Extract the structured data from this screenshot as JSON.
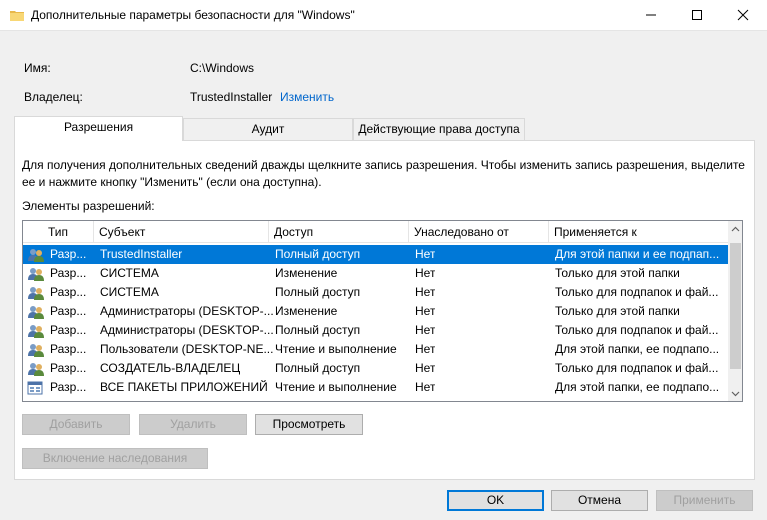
{
  "window": {
    "title": "Дополнительные параметры безопасности  для \"Windows\"",
    "minimize_glyph": "—",
    "maximize_glyph": "☐",
    "close_glyph": "✕"
  },
  "info": {
    "name_label": "Имя:",
    "name_value": "C:\\Windows",
    "owner_label": "Владелец:",
    "owner_value": "TrustedInstaller",
    "change_link": "Изменить"
  },
  "tabs": [
    {
      "label": "Разрешения",
      "active": true
    },
    {
      "label": "Аудит",
      "active": false
    },
    {
      "label": "Действующие права доступа",
      "active": false
    }
  ],
  "panel": {
    "description_line1": "Для получения дополнительных сведений дважды щелкните запись разрешения. Чтобы изменить запись разрешения, выделите",
    "description_line2": "ее и нажмите кнопку \"Изменить\" (если она доступна).",
    "list_label": "Элементы разрешений:"
  },
  "table": {
    "columns": [
      "Тип",
      "Субъект",
      "Доступ",
      "Унаследовано от",
      "Применяется к"
    ],
    "rows": [
      {
        "icon": "users-icon",
        "type": "Разр...",
        "subject": "TrustedInstaller",
        "access": "Полный доступ",
        "inherited": "Нет",
        "applies": "Для этой папки и ее подпап...",
        "selected": true
      },
      {
        "icon": "users-icon",
        "type": "Разр...",
        "subject": "СИСТЕМА",
        "access": "Изменение",
        "inherited": "Нет",
        "applies": "Только для этой папки",
        "selected": false
      },
      {
        "icon": "users-icon",
        "type": "Разр...",
        "subject": "СИСТЕМА",
        "access": "Полный доступ",
        "inherited": "Нет",
        "applies": "Только для подпапок и фай...",
        "selected": false
      },
      {
        "icon": "users-icon",
        "type": "Разр...",
        "subject": "Администраторы (DESKTOP-...",
        "access": "Изменение",
        "inherited": "Нет",
        "applies": "Только для этой папки",
        "selected": false
      },
      {
        "icon": "users-icon",
        "type": "Разр...",
        "subject": "Администраторы (DESKTOP-...",
        "access": "Полный доступ",
        "inherited": "Нет",
        "applies": "Только для подпапок и фай...",
        "selected": false
      },
      {
        "icon": "users-icon",
        "type": "Разр...",
        "subject": "Пользователи (DESKTOP-NE...",
        "access": "Чтение и выполнение",
        "inherited": "Нет",
        "applies": "Для этой папки, ее подпапо...",
        "selected": false
      },
      {
        "icon": "users-icon",
        "type": "Разр...",
        "subject": "СОЗДАТЕЛЬ-ВЛАДЕЛЕЦ",
        "access": "Полный доступ",
        "inherited": "Нет",
        "applies": "Только для подпапок и фай...",
        "selected": false
      },
      {
        "icon": "app-packages-icon",
        "type": "Разр...",
        "subject": "ВСЕ ПАКЕТЫ ПРИЛОЖЕНИЙ",
        "access": "Чтение и выполнение",
        "inherited": "Нет",
        "applies": "Для этой папки, ее подпапо...",
        "selected": false
      }
    ]
  },
  "buttons": {
    "add": "Добавить",
    "remove": "Удалить",
    "view": "Просмотреть",
    "enable_inheritance": "Включение наследования",
    "ok": "OK",
    "cancel": "Отмена",
    "apply": "Применить"
  },
  "colors": {
    "selection": "#0078d7",
    "link": "#0066cc"
  }
}
